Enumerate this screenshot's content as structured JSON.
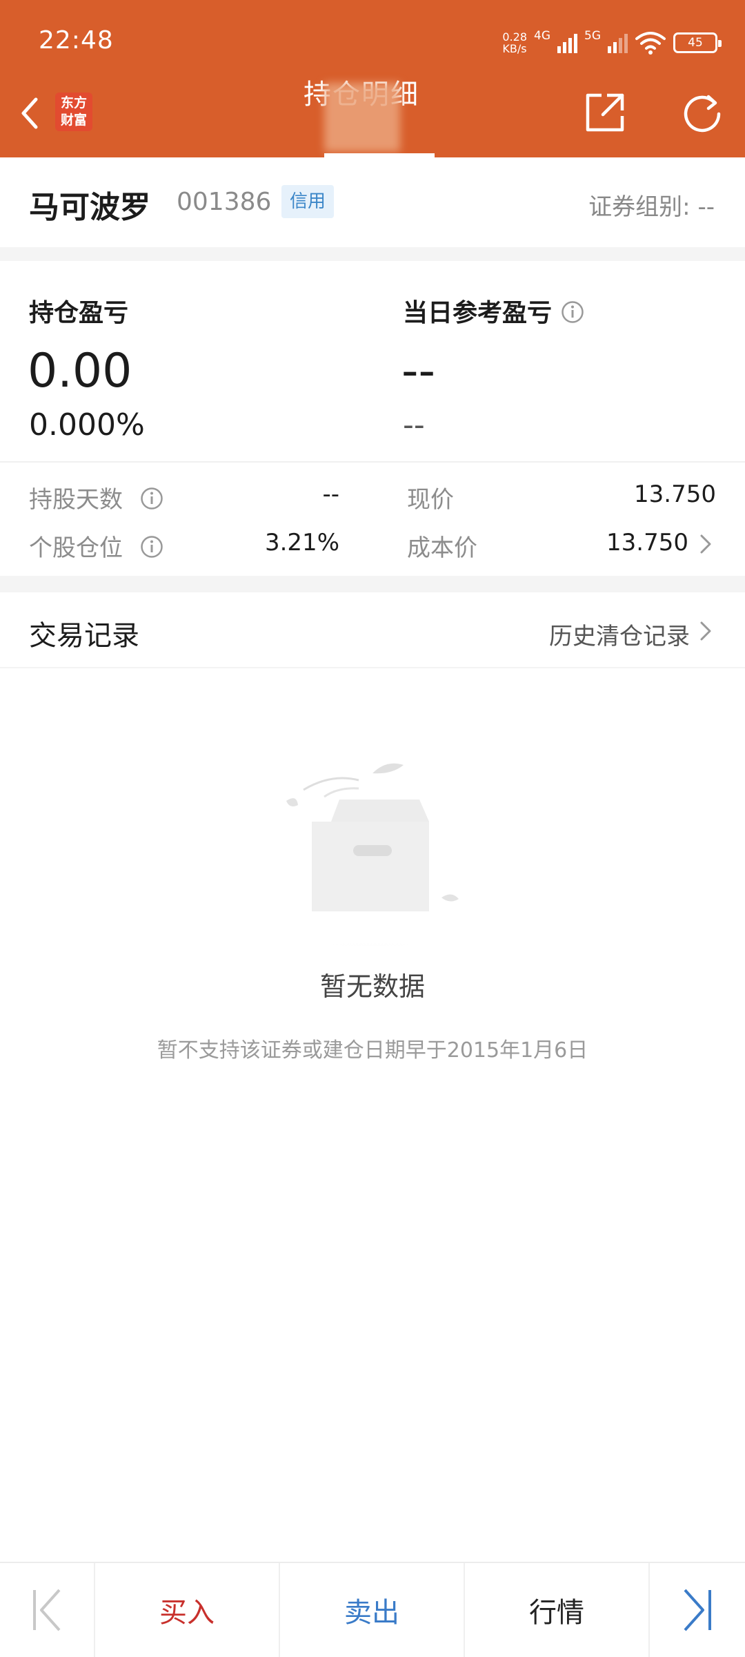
{
  "status_bar": {
    "time": "22:48",
    "net_speed_value": "0.28",
    "net_speed_unit": "KB/s",
    "sim1_tag": "4G",
    "sim2_tag": "5G",
    "battery": "45"
  },
  "header": {
    "title": "持仓明细",
    "logo_line1": "东方",
    "logo_line2": "财富",
    "background_color": "#d85e2b"
  },
  "stock": {
    "name": "马可波罗",
    "code": "001386",
    "tag": "信用",
    "group_label": "证券组别:",
    "group_value": "--"
  },
  "pnl": {
    "holding_title": "持仓盈亏",
    "holding_value": "0.00",
    "holding_percent": "0.000%",
    "daily_title": "当日参考盈亏",
    "daily_value": "--",
    "daily_sub": "--"
  },
  "stats": {
    "hold_days_label": "持股天数",
    "hold_days_value": "--",
    "position_label": "个股仓位",
    "position_value": "3.21%",
    "price_label": "现价",
    "price_value": "13.750",
    "cost_label": "成本价",
    "cost_value": "13.750"
  },
  "trades": {
    "title": "交易记录",
    "history_link": "历史清仓记录",
    "empty_title": "暂无数据",
    "empty_note": "暂不支持该证券或建仓日期早于2015年1月6日"
  },
  "toolbar": {
    "buy": "买入",
    "sell": "卖出",
    "quote": "行情",
    "buy_color": "#c8302c",
    "sell_color": "#3a7bc8"
  }
}
